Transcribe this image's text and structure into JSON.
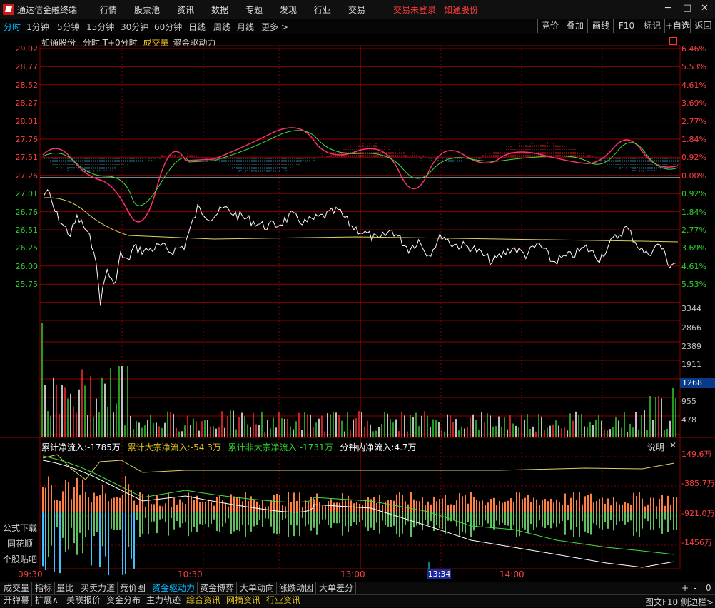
{
  "app": {
    "title": "通达信金融终端",
    "menu": [
      "行情",
      "股票池",
      "资讯",
      "数据",
      "专题",
      "发现",
      "行业",
      "交易"
    ],
    "login_status": "交易未登录",
    "stock_name": "如通股份",
    "window_buttons": [
      "─",
      "□",
      "✕"
    ]
  },
  "periods": {
    "items": [
      "分时",
      "1分钟",
      "5分钟",
      "15分钟",
      "30分钟",
      "60分钟",
      "日线",
      "周线",
      "月线",
      "更多 >"
    ],
    "active": 0
  },
  "right_buttons": [
    "竞价",
    "叠加",
    "画线",
    "F10",
    "标记",
    "+自选",
    "返回"
  ],
  "chart": {
    "header": {
      "name": "如通股份",
      "mode": "分时 T+0分时",
      "indicator1": "成交量",
      "indicator2": "资金驱动力"
    },
    "price_ticks": [
      "29.02",
      "28.77",
      "28.52",
      "28.27",
      "28.01",
      "27.76",
      "27.51",
      "27.26",
      "27.01",
      "26.76",
      "26.51",
      "26.25",
      "26.00",
      "25.75"
    ],
    "pct_ticks": [
      "6.46%",
      "5.53%",
      "4.61%",
      "3.69%",
      "2.77%",
      "1.84%",
      "0.92%",
      "0.00%",
      "0.92%",
      "1.84%",
      "2.77%",
      "3.69%",
      "4.61%",
      "5.53%"
    ],
    "volume_ticks": [
      "3344",
      "2866",
      "2389",
      "1911",
      "1268",
      "955",
      "478"
    ],
    "volume_highlight": "1268",
    "flow_header": {
      "total": "累计净流入:-1785万",
      "big": "累计大宗净流入:-54.3万",
      "nonbig": "累计非大宗净流入:-1731万",
      "minute": "分钟内净流入:4.7万",
      "explain": "说明"
    },
    "flow_ticks": [
      "149.6万",
      "-385.7万",
      "-921.0万",
      "-1456万"
    ],
    "time_ticks": [
      "09:30",
      "10:30",
      "13:00",
      "14:00"
    ],
    "cursor_time": "13:34",
    "left_side": [
      "公式下载",
      "同花顺",
      "个股贴吧"
    ],
    "colors": {
      "up": "#ff3030",
      "down": "#30d030",
      "grid": "#8a0000",
      "price_line": "#ffffff",
      "avg_line": "#e0d060"
    }
  },
  "bottom_tabs": {
    "row1": [
      "成交量",
      "指标",
      "量比",
      "买卖力道",
      "竞价图",
      "资金驱动力",
      "资金博弈",
      "大单动向",
      "涨跌动因",
      "大单差分"
    ],
    "active": 5,
    "row1_right": [
      "+",
      "-",
      "0"
    ],
    "row2": [
      "开弹幕",
      "扩展∧",
      "关联报价",
      "资金分布",
      "主力轨迹",
      "综合资讯",
      "网摘资讯",
      "行业资讯"
    ],
    "row2_yellow": [
      5,
      6,
      7
    ],
    "row2_right": [
      "图文F10",
      "侧边栏>"
    ]
  }
}
